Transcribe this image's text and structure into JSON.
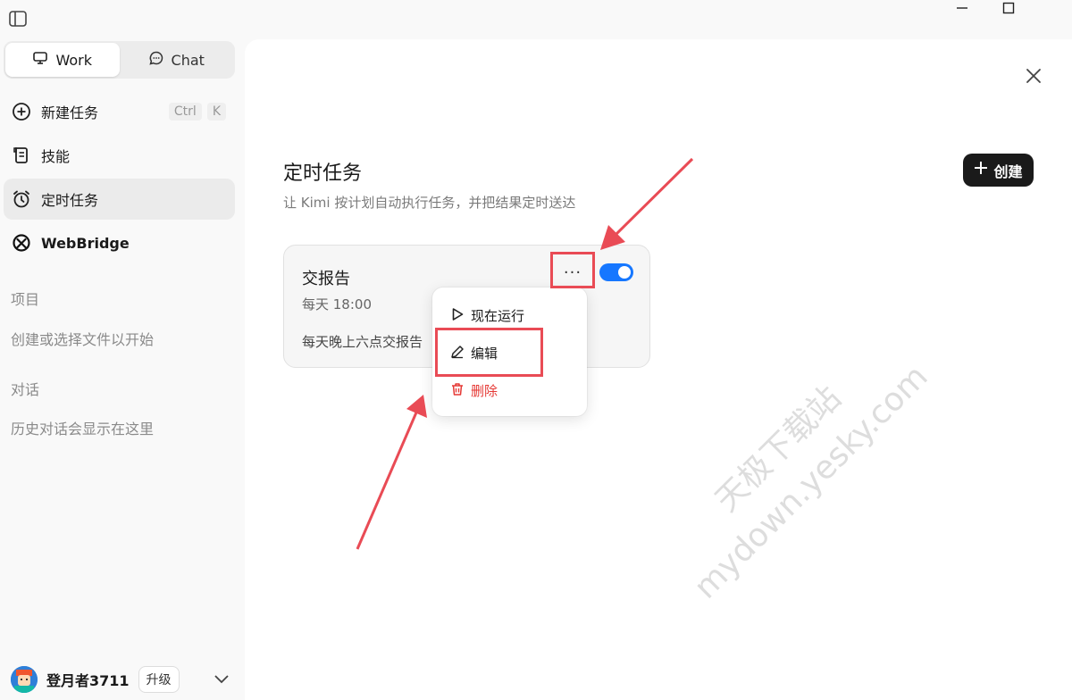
{
  "window": {
    "controls": [
      "minimize-icon",
      "maximize-icon"
    ]
  },
  "sidebar": {
    "modes": [
      {
        "label": "Work",
        "icon": "monitor-icon",
        "active": true
      },
      {
        "label": "Chat",
        "icon": "chat-bubble-icon",
        "active": false
      }
    ],
    "items": [
      {
        "label": "新建任务",
        "icon": "plus-circle-icon",
        "shortcut": [
          "Ctrl",
          "K"
        ]
      },
      {
        "label": "技能",
        "icon": "scroll-icon"
      },
      {
        "label": "定时任务",
        "icon": "alarm-clock-icon",
        "active": true
      },
      {
        "label": "WebBridge",
        "icon": "webbridge-icon"
      }
    ],
    "projects": {
      "label": "项目",
      "hint": "创建或选择文件以开始"
    },
    "conversations": {
      "label": "对话",
      "hint": "历史对话会显示在这里"
    },
    "user": {
      "name": "登月者3711",
      "upgrade_label": "升级"
    }
  },
  "main": {
    "title": "定时任务",
    "subtitle": "让 Kimi 按计划自动执行任务，并把结果定时送达",
    "create_label": "创建",
    "task": {
      "title": "交报告",
      "schedule": "每天 18:00",
      "description": "每天晚上六点交报告",
      "enabled": true,
      "more_label": "···"
    },
    "menu": [
      {
        "label": "现在运行",
        "icon": "play-icon"
      },
      {
        "label": "编辑",
        "icon": "pencil-icon"
      },
      {
        "label": "删除",
        "icon": "trash-icon"
      }
    ]
  },
  "watermark": {
    "line1": "天极下载站",
    "line2": "mydown.yesky.com"
  },
  "colors": {
    "accent": "#1677ff",
    "danger": "#e53935",
    "annotation": "#e94b55",
    "create_button": "#1a1a1a"
  }
}
